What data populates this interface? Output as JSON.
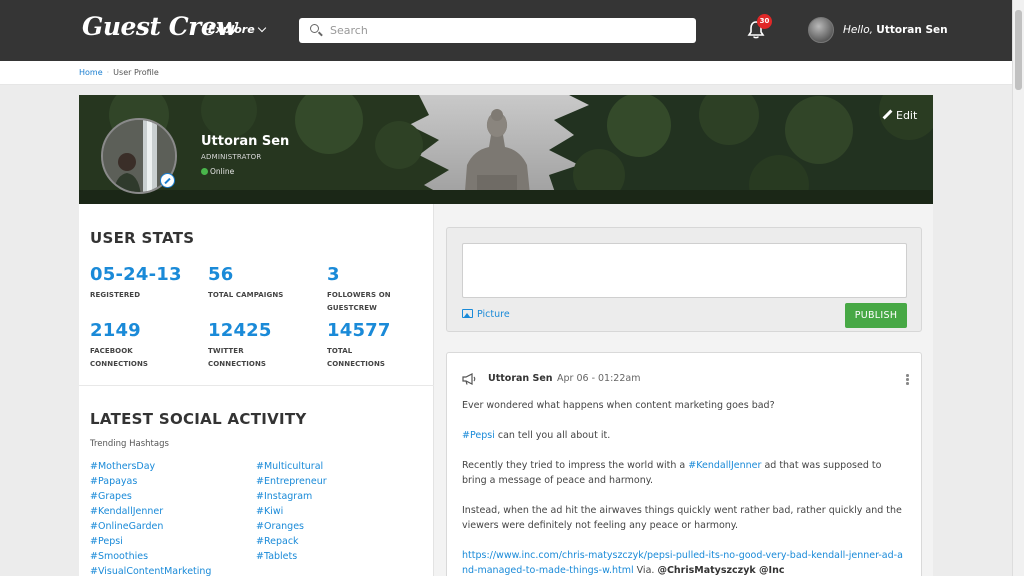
{
  "header": {
    "logo": "Guest Crew",
    "explore_label": "Explore",
    "search_placeholder": "Search",
    "search_value": "",
    "notifications_count": "30",
    "greeting": "Hello,",
    "user_name": "Uttoran Sen"
  },
  "breadcrumb": {
    "home": "Home",
    "current": "User Profile"
  },
  "profile": {
    "name": "Uttoran Sen",
    "role": "ADMINISTRATOR",
    "status": "Online",
    "edit_label": "Edit"
  },
  "user_stats": {
    "title": "USER STATS",
    "items": [
      {
        "value": "05-24-13",
        "label": "REGISTERED"
      },
      {
        "value": "56",
        "label": "TOTAL CAMPAIGNS"
      },
      {
        "value": "3",
        "label": "FOLLOWERS ON GUESTCREW"
      },
      {
        "value": "2149",
        "label": "FACEBOOK CONNECTIONS"
      },
      {
        "value": "12425",
        "label": "TWITTER CONNECTIONS"
      },
      {
        "value": "14577",
        "label": "TOTAL CONNECTIONS"
      }
    ]
  },
  "social_activity": {
    "title": "LATEST SOCIAL ACTIVITY",
    "trending_label": "Trending Hashtags",
    "hashtags_left": [
      "#MothersDay",
      "#Papayas",
      "#Grapes",
      "#KendallJenner",
      "#OnlineGarden",
      "#Pepsi",
      "#Smoothies",
      "#VisualContentMarketing"
    ],
    "hashtags_right": [
      "#Multicultural",
      "#Entrepreneur",
      "#Instagram",
      "#Kiwi",
      "#Oranges",
      "#Repack",
      "#Tablets"
    ]
  },
  "composer": {
    "value": "",
    "picture_label": "Picture",
    "publish_label": "PUBLISH"
  },
  "post": {
    "author": "Uttoran Sen",
    "time": "Apr 06 - 01:22am",
    "line1": "Ever wondered what happens when content marketing goes bad?",
    "line2_tag": "#Pepsi",
    "line2_text": " can tell you all about it.",
    "line3_a": "Recently they tried to impress the world with a ",
    "line3_tag": "#KendallJenner",
    "line3_b": " ad that was supposed to bring a message of peace and harmony.",
    "line4": "Instead, when the ad hit the airwaves things quickly went rather bad, rather quickly and the viewers were definitely not feeling any peace or harmony.",
    "link": "https://www.inc.com/chris-matyszczyk/pepsi-pulled-its-no-good-very-bad-kendall-jenner-ad-and-managed-to-made-things-w.html",
    "via_label": " Via. ",
    "via_handles": "@ChrisMatyszczyk @Inc"
  },
  "icons": {
    "search": "search-icon",
    "bell": "bell-icon",
    "pencil": "pencil-icon",
    "picture": "picture-icon",
    "megaphone": "megaphone-icon",
    "menu": "kebab-menu-icon"
  },
  "colors": {
    "navbar": "#353535",
    "accent_blue": "#1a8ad8",
    "publish_green": "#47a845",
    "badge_red": "#e02828",
    "online_green": "#49b64b"
  }
}
